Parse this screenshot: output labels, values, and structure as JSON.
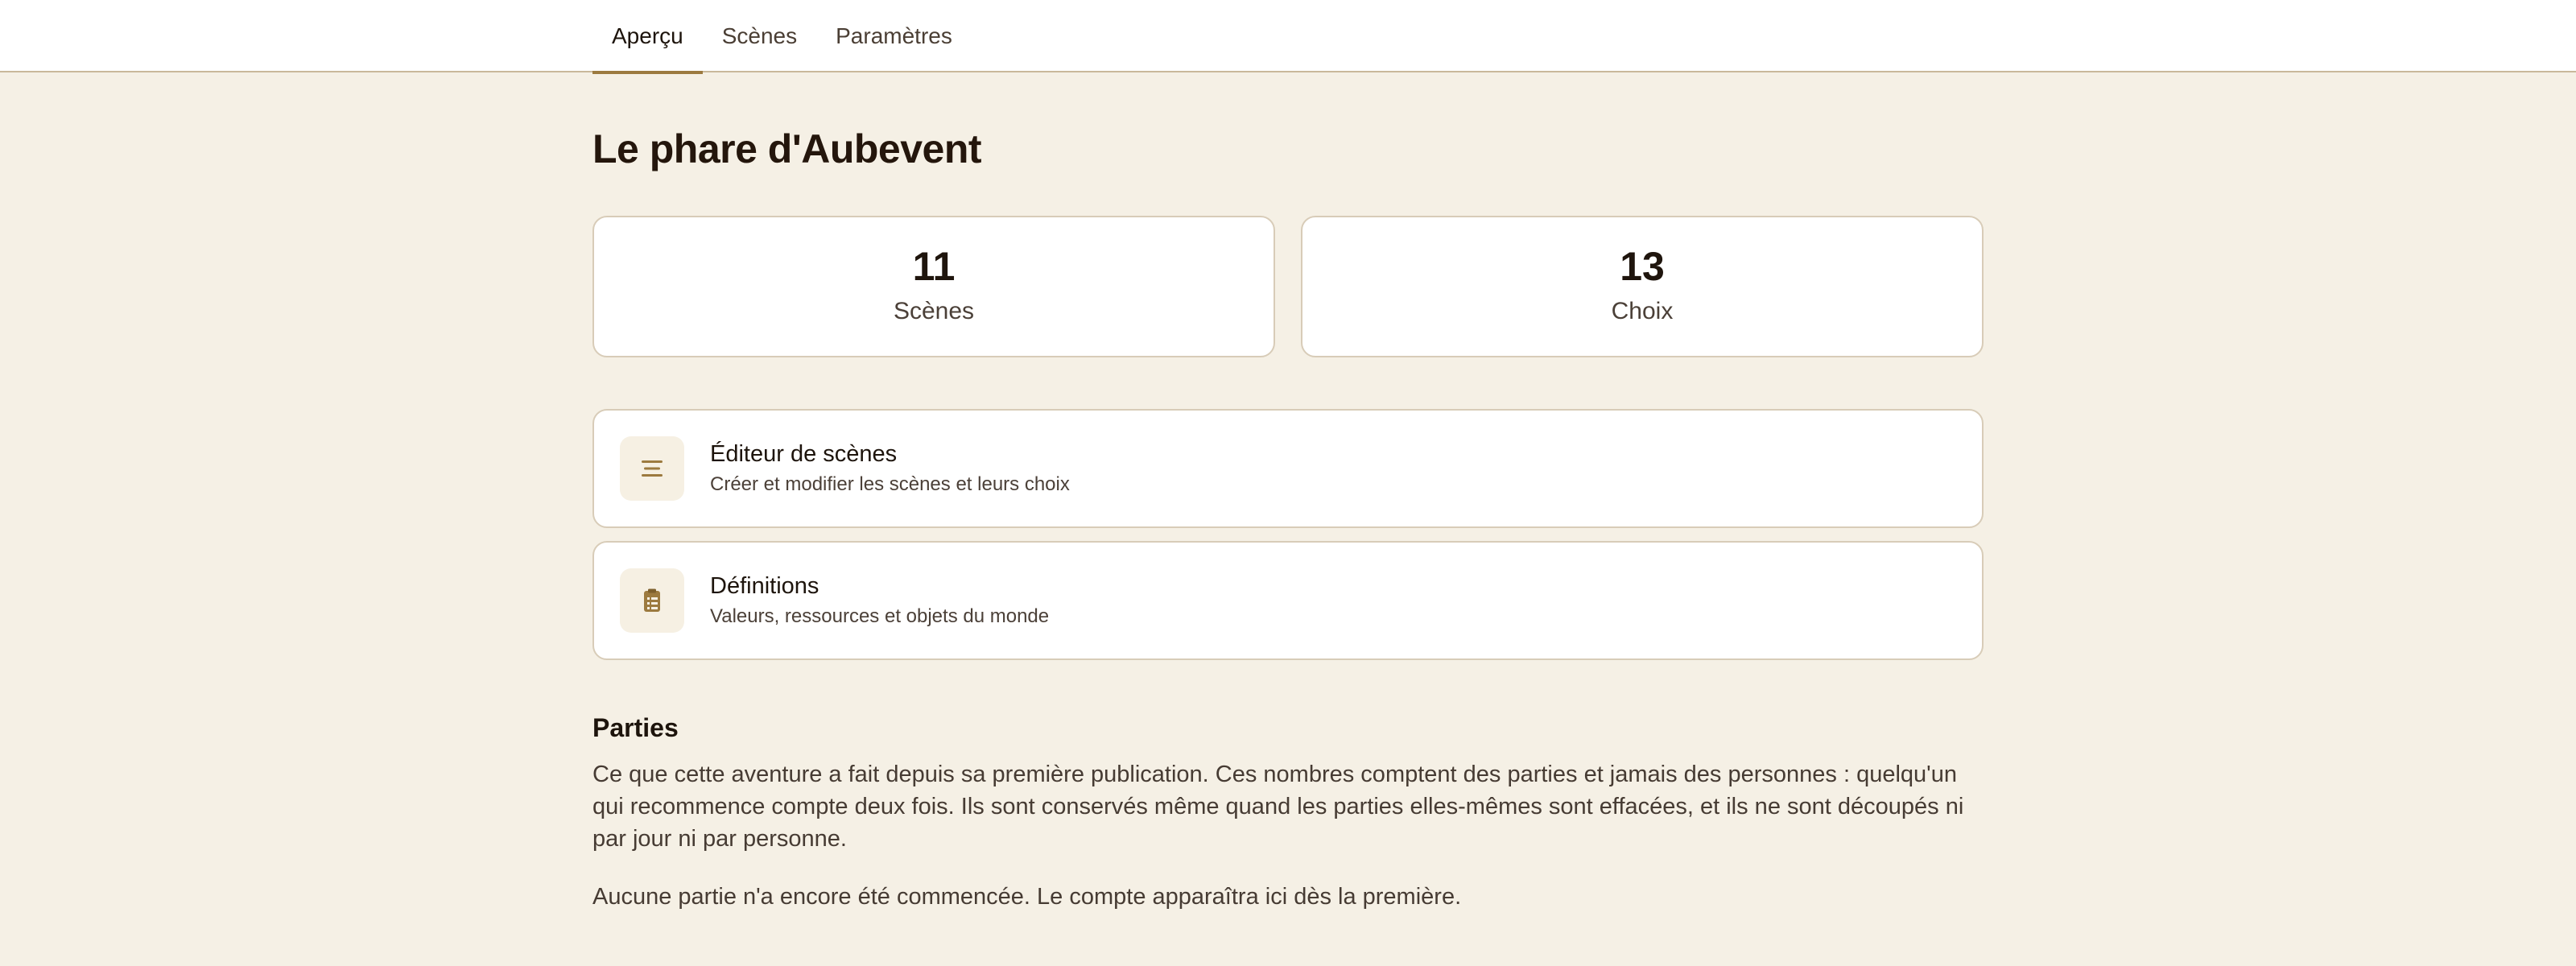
{
  "nav": {
    "tabs": [
      {
        "label": "Aperçu",
        "active": true
      },
      {
        "label": "Scènes",
        "active": false
      },
      {
        "label": "Paramètres",
        "active": false
      }
    ]
  },
  "page": {
    "title": "Le phare d'Aubevent"
  },
  "stats": [
    {
      "value": "11",
      "label": "Scènes"
    },
    {
      "value": "13",
      "label": "Choix"
    }
  ],
  "cards": [
    {
      "icon": "list-lines-icon",
      "title": "Éditeur de scènes",
      "subtitle": "Créer et modifier les scènes et leurs choix"
    },
    {
      "icon": "clipboard-list-icon",
      "title": "Définitions",
      "subtitle": "Valeurs, ressources et objets du monde"
    }
  ],
  "plays": {
    "title": "Parties",
    "description": "Ce que cette aventure a fait depuis sa première publication. Ces nombres comptent des parties et jamais des personnes : quelqu'un qui recommence compte deux fois. Ils sont conservés même quand les parties elles-mêmes sont effacées, et ils ne sont découpés ni par jour ni par personne.",
    "empty_message": "Aucune partie n'a encore été commencée. Le compte apparaîtra ici dès la première."
  },
  "colors": {
    "background": "#f5f0e5",
    "accent": "#9c7a3f",
    "border": "#d8ccb8"
  }
}
